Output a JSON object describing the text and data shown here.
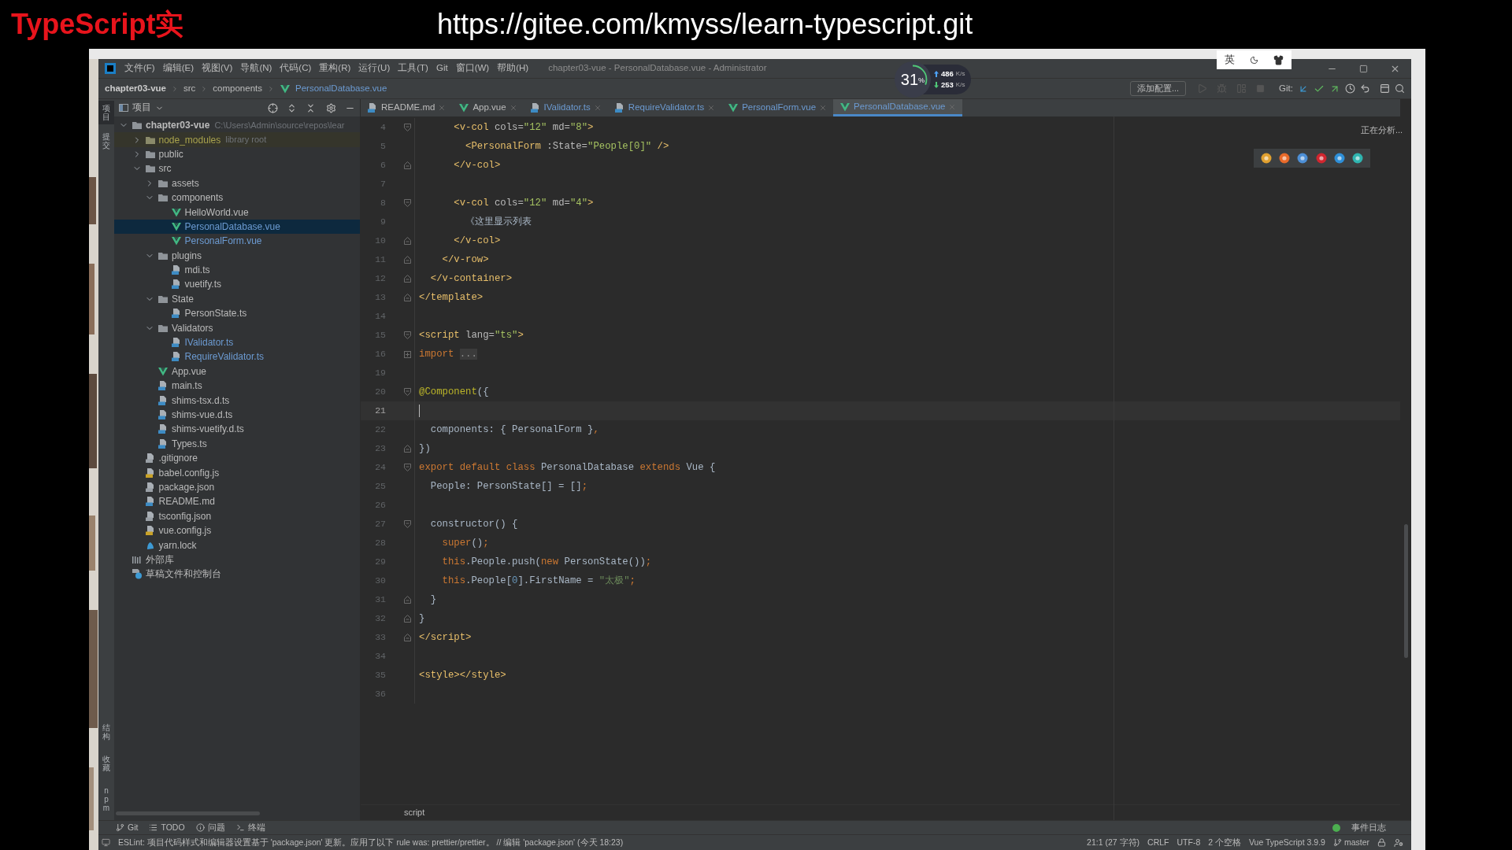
{
  "banner": {
    "title": "TypeScript实",
    "url": "https://gitee.com/kmyss/learn-typescript.git"
  },
  "window": {
    "title": "chapter03-vue - PersonalDatabase.vue - Administrator",
    "menu": [
      "文件(F)",
      "编辑(E)",
      "视图(V)",
      "导航(N)",
      "代码(C)",
      "重构(R)",
      "运行(U)",
      "工具(T)",
      "Git",
      "窗口(W)",
      "帮助(H)"
    ]
  },
  "ime_bar": {
    "label": "英"
  },
  "net_monitor": {
    "percent": "31",
    "unit": "%",
    "up": "486",
    "up_unit": "K/s",
    "down": "253",
    "down_unit": "K/s"
  },
  "breadcrumb": [
    {
      "label": "chapter03-vue",
      "kind": "project"
    },
    {
      "label": "src",
      "kind": "folder"
    },
    {
      "label": "components",
      "kind": "folder"
    },
    {
      "label": "PersonalDatabase.vue",
      "kind": "vue"
    }
  ],
  "toolbar": {
    "run_config": "添加配置...",
    "git_label": "Git:"
  },
  "side_strip": {
    "top": [
      {
        "label": "项目",
        "selected": true
      },
      {
        "label": "提交",
        "selected": false
      }
    ],
    "bottom": [
      {
        "label": "结构",
        "selected": false
      },
      {
        "label": "收藏",
        "selected": false
      },
      {
        "label": "npm",
        "selected": false
      }
    ]
  },
  "project_panel": {
    "title": "项目",
    "tree": [
      {
        "name": "chapter03-vue",
        "kind": "folder",
        "hint": "C:\\Users\\Admin\\source\\repos\\lear",
        "modified": false,
        "expanded": true,
        "selected": false,
        "children": [
          {
            "name": "node_modules",
            "kind": "excluded-folder",
            "hint": "library root",
            "modified": false,
            "expanded": false,
            "selected": false
          },
          {
            "name": "public",
            "kind": "folder",
            "modified": false,
            "expanded": false,
            "selected": false
          },
          {
            "name": "src",
            "kind": "folder",
            "modified": false,
            "expanded": true,
            "selected": false,
            "children": [
              {
                "name": "assets",
                "kind": "folder",
                "modified": false,
                "expanded": false,
                "selected": false
              },
              {
                "name": "components",
                "kind": "folder",
                "modified": false,
                "expanded": true,
                "selected": false,
                "children": [
                  {
                    "name": "HelloWorld.vue",
                    "kind": "vue",
                    "modified": false,
                    "selected": false
                  },
                  {
                    "name": "PersonalDatabase.vue",
                    "kind": "vue",
                    "modified": true,
                    "selected": true
                  },
                  {
                    "name": "PersonalForm.vue",
                    "kind": "vue",
                    "modified": true,
                    "selected": false
                  }
                ]
              },
              {
                "name": "plugins",
                "kind": "folder",
                "modified": false,
                "expanded": true,
                "selected": false,
                "children": [
                  {
                    "name": "mdi.ts",
                    "kind": "ts",
                    "modified": false,
                    "selected": false
                  },
                  {
                    "name": "vuetify.ts",
                    "kind": "ts",
                    "modified": false,
                    "selected": false
                  }
                ]
              },
              {
                "name": "State",
                "kind": "folder",
                "modified": false,
                "expanded": true,
                "selected": false,
                "children": [
                  {
                    "name": "PersonState.ts",
                    "kind": "ts",
                    "modified": false,
                    "selected": false
                  }
                ]
              },
              {
                "name": "Validators",
                "kind": "folder",
                "modified": false,
                "expanded": true,
                "selected": false,
                "children": [
                  {
                    "name": "IValidator.ts",
                    "kind": "ts",
                    "modified": true,
                    "selected": false
                  },
                  {
                    "name": "RequireValidator.ts",
                    "kind": "ts",
                    "modified": true,
                    "selected": false
                  }
                ]
              },
              {
                "name": "App.vue",
                "kind": "vue",
                "modified": false,
                "selected": false
              },
              {
                "name": "main.ts",
                "kind": "ts",
                "modified": false,
                "selected": false
              },
              {
                "name": "shims-tsx.d.ts",
                "kind": "ts",
                "modified": false,
                "selected": false
              },
              {
                "name": "shims-vue.d.ts",
                "kind": "ts",
                "modified": false,
                "selected": false
              },
              {
                "name": "shims-vuetify.d.ts",
                "kind": "ts",
                "modified": false,
                "selected": false
              },
              {
                "name": "Types.ts",
                "kind": "ts",
                "modified": false,
                "selected": false
              }
            ]
          },
          {
            "name": ".gitignore",
            "kind": "ignore",
            "modified": false,
            "selected": false
          },
          {
            "name": "babel.config.js",
            "kind": "js",
            "modified": false,
            "selected": false
          },
          {
            "name": "package.json",
            "kind": "json",
            "modified": false,
            "selected": false
          },
          {
            "name": "README.md",
            "kind": "md",
            "modified": false,
            "selected": false
          },
          {
            "name": "tsconfig.json",
            "kind": "json",
            "modified": false,
            "selected": false
          },
          {
            "name": "vue.config.js",
            "kind": "js",
            "modified": false,
            "selected": false
          },
          {
            "name": "yarn.lock",
            "kind": "yarn",
            "modified": false,
            "selected": false
          }
        ]
      },
      {
        "name": "外部库",
        "kind": "libraries",
        "modified": false,
        "selected": false
      },
      {
        "name": "草稿文件和控制台",
        "kind": "scratches",
        "modified": false,
        "selected": false
      }
    ]
  },
  "tabs": [
    {
      "label": "README.md",
      "kind": "md",
      "color": "#bbbbbb",
      "selected": false
    },
    {
      "label": "App.vue",
      "kind": "vue",
      "color": "#bbbbbb",
      "selected": false
    },
    {
      "label": "IValidator.ts",
      "kind": "ts",
      "color": "#6c9bd2",
      "selected": false
    },
    {
      "label": "RequireValidator.ts",
      "kind": "ts",
      "color": "#6c9bd2",
      "selected": false
    },
    {
      "label": "PersonalForm.vue",
      "kind": "vue",
      "color": "#6c9bd2",
      "selected": false
    },
    {
      "label": "PersonalDatabase.vue",
      "kind": "vue",
      "color": "#6c9bd2",
      "selected": true
    }
  ],
  "editor": {
    "status": "正在分析...",
    "lines": [
      {
        "n": "4",
        "kind": "fold-start",
        "current": false,
        "tokens": [
          {
            "kind": "tag",
            "t": "      <v-col"
          },
          {
            "kind": "attr",
            "t": " cols="
          },
          {
            "kind": "value",
            "t": "\"12\""
          },
          {
            "kind": "attr",
            "t": " md="
          },
          {
            "kind": "value",
            "t": "\"8\""
          },
          {
            "kind": "tag",
            "t": ">"
          }
        ]
      },
      {
        "n": "5",
        "kind": "plain",
        "current": false,
        "tokens": [
          {
            "kind": "tag",
            "t": "        <PersonalForm"
          },
          {
            "kind": "attr",
            "t": " :State="
          },
          {
            "kind": "value",
            "t": "\"People[0]\""
          },
          {
            "kind": "tag",
            "t": " />"
          }
        ]
      },
      {
        "n": "6",
        "kind": "fold-end",
        "current": false,
        "tokens": [
          {
            "kind": "tag",
            "t": "      </v-col>"
          }
        ]
      },
      {
        "n": "7",
        "kind": "plain",
        "current": false
      },
      {
        "n": "8",
        "kind": "fold-start",
        "current": false,
        "tokens": [
          {
            "kind": "tag",
            "t": "      <v-col"
          },
          {
            "kind": "attr",
            "t": " cols="
          },
          {
            "kind": "value",
            "t": "\"12\""
          },
          {
            "kind": "attr",
            "t": " md="
          },
          {
            "kind": "value",
            "t": "\"4\""
          },
          {
            "kind": "tag",
            "t": ">"
          }
        ]
      },
      {
        "n": "9",
        "kind": "plain",
        "current": false,
        "tokens": [
          {
            "kind": "plain",
            "t": "        《这里显示列表"
          }
        ]
      },
      {
        "n": "10",
        "kind": "fold-end",
        "current": false,
        "tokens": [
          {
            "kind": "tag",
            "t": "      </v-col>"
          }
        ]
      },
      {
        "n": "11",
        "kind": "fold-end",
        "current": false,
        "tokens": [
          {
            "kind": "tag",
            "t": "    </v-row>"
          }
        ]
      },
      {
        "n": "12",
        "kind": "fold-end",
        "current": false,
        "tokens": [
          {
            "kind": "tag",
            "t": "  </v-container>"
          }
        ]
      },
      {
        "n": "13",
        "kind": "fold-end",
        "current": false,
        "tokens": [
          {
            "kind": "tag",
            "t": "</template>"
          }
        ]
      },
      {
        "n": "14",
        "kind": "plain",
        "current": false
      },
      {
        "n": "15",
        "kind": "fold-start",
        "current": false,
        "tokens": [
          {
            "kind": "tag",
            "t": "<script"
          },
          {
            "kind": "attr",
            "t": " lang="
          },
          {
            "kind": "value",
            "t": "\"ts\""
          },
          {
            "kind": "tag",
            "t": ">"
          }
        ]
      },
      {
        "n": "16",
        "kind": "collapsed",
        "current": false,
        "tokens": [
          {
            "kind": "keyword",
            "t": "import "
          },
          {
            "kind": "folded",
            "t": "..."
          }
        ]
      },
      {
        "n": "19",
        "kind": "plain",
        "current": false
      },
      {
        "n": "20",
        "kind": "fold-start",
        "current": false,
        "tokens": [
          {
            "kind": "annotation",
            "t": "@Component"
          },
          {
            "kind": "plain",
            "t": "({"
          }
        ]
      },
      {
        "n": "21",
        "kind": "plain",
        "current": true
      },
      {
        "n": "22",
        "kind": "plain",
        "current": false,
        "tokens": [
          {
            "kind": "plain",
            "t": "  components: { PersonalForm }"
          },
          {
            "kind": "keyword",
            "t": ","
          }
        ]
      },
      {
        "n": "23",
        "kind": "fold-end",
        "current": false,
        "tokens": [
          {
            "kind": "plain",
            "t": "})"
          }
        ]
      },
      {
        "n": "24",
        "kind": "fold-start",
        "current": false,
        "tokens": [
          {
            "kind": "keyword",
            "t": "export default class "
          },
          {
            "kind": "plain",
            "t": "PersonalDatabase "
          },
          {
            "kind": "keyword",
            "t": "extends "
          },
          {
            "kind": "plain",
            "t": "Vue {"
          }
        ]
      },
      {
        "n": "25",
        "kind": "plain",
        "current": false,
        "tokens": [
          {
            "kind": "plain",
            "t": "  People: PersonState[] = []"
          },
          {
            "kind": "keyword",
            "t": ";"
          }
        ]
      },
      {
        "n": "26",
        "kind": "plain",
        "current": false
      },
      {
        "n": "27",
        "kind": "fold-start",
        "current": false,
        "tokens": [
          {
            "kind": "plain",
            "t": "  constructor() {"
          }
        ]
      },
      {
        "n": "28",
        "kind": "plain",
        "current": false,
        "tokens": [
          {
            "kind": "keyword",
            "t": "    super"
          },
          {
            "kind": "plain",
            "t": "()"
          },
          {
            "kind": "keyword",
            "t": ";"
          }
        ]
      },
      {
        "n": "29",
        "kind": "plain",
        "current": false,
        "tokens": [
          {
            "kind": "keyword",
            "t": "    this"
          },
          {
            "kind": "plain",
            "t": ".People.push("
          },
          {
            "kind": "keyword",
            "t": "new "
          },
          {
            "kind": "plain",
            "t": "PersonState())"
          },
          {
            "kind": "keyword",
            "t": ";"
          }
        ]
      },
      {
        "n": "30",
        "kind": "plain",
        "current": false,
        "tokens": [
          {
            "kind": "keyword",
            "t": "    this"
          },
          {
            "kind": "plain",
            "t": ".People["
          },
          {
            "kind": "number",
            "t": "0"
          },
          {
            "kind": "plain",
            "t": "].FirstName = "
          },
          {
            "kind": "string",
            "t": "\"太极\""
          },
          {
            "kind": "keyword",
            "t": ";"
          }
        ]
      },
      {
        "n": "31",
        "kind": "fold-end",
        "current": false,
        "tokens": [
          {
            "kind": "plain",
            "t": "  }"
          }
        ]
      },
      {
        "n": "32",
        "kind": "fold-end",
        "current": false,
        "tokens": [
          {
            "kind": "plain",
            "t": "}"
          }
        ]
      },
      {
        "n": "33",
        "kind": "fold-end",
        "current": false,
        "tokens": [
          {
            "kind": "tag",
            "t": "</script>"
          }
        ]
      },
      {
        "n": "34",
        "kind": "plain",
        "current": false
      },
      {
        "n": "35",
        "kind": "plain",
        "current": false,
        "tokens": [
          {
            "kind": "tag",
            "t": "<style></style>"
          }
        ]
      },
      {
        "n": "36",
        "kind": "plain",
        "current": false
      }
    ],
    "breadcrumb": "script"
  },
  "tool_windows": [
    {
      "label": "Git",
      "kind": "git"
    },
    {
      "label": "TODO",
      "kind": "todo"
    },
    {
      "label": "问题",
      "kind": "problems"
    },
    {
      "label": "终端",
      "kind": "terminal"
    }
  ],
  "event_log": "事件日志",
  "status_bar": {
    "message": "ESLint: 项目代码样式和编辑器设置基于 'package.json' 更新。应用了以下 rule was: prettier/prettier。 // 编辑 'package.json' (今天 18:23)",
    "items": [
      "21:1 (27 字符)",
      "CRLF",
      "UTF-8",
      "2 个空格",
      "Vue TypeScript 3.9.9"
    ],
    "branch": "master"
  }
}
